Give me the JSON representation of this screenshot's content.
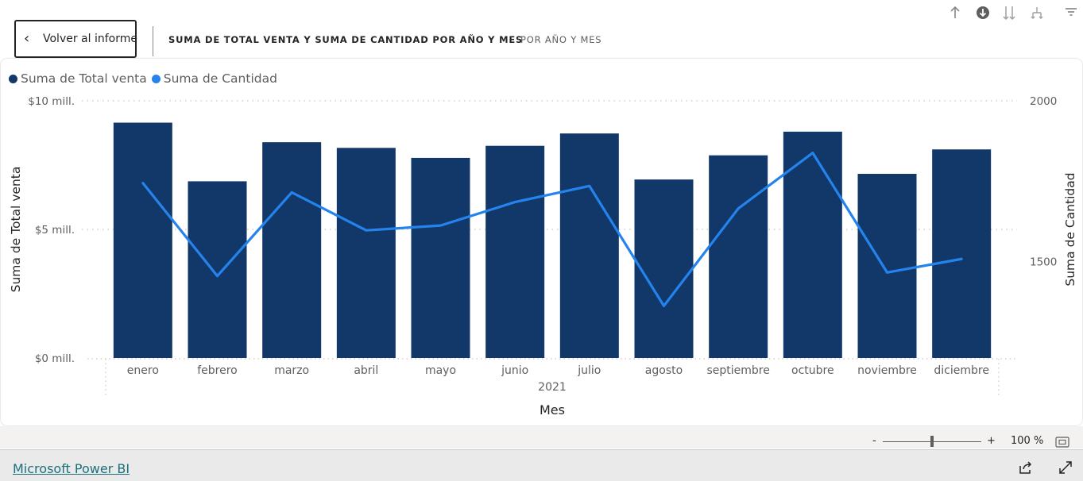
{
  "header": {
    "back_label": "Volver al informe",
    "title_main": "SUMA DE TOTAL VENTA Y SUMA DE CANTIDAD POR AÑO Y MES",
    "title_sub": "POR AÑO Y MES"
  },
  "toolbar_icons": [
    "arrow-up-icon",
    "drill-down-icon",
    "expand-all-down-icon",
    "expand-hierarchy-icon",
    "filter-icon"
  ],
  "legend": {
    "items": [
      {
        "label": "Suma de Total venta",
        "color": "#12386a"
      },
      {
        "label": "Suma de Cantidad",
        "color": "#2483ec"
      }
    ]
  },
  "chart_data": {
    "type": "bar",
    "combo": "bar+line",
    "categories": [
      "enero",
      "febrero",
      "marzo",
      "abril",
      "mayo",
      "junio",
      "julio",
      "agosto",
      "septiembre",
      "octubre",
      "noviembre",
      "diciembre"
    ],
    "x_group_label": "2021",
    "xlabel": "Mes",
    "ylabel": "Suma de Total venta",
    "y2label": "Suma de Cantidad",
    "ylim": [
      0,
      10000000
    ],
    "y2lim": [
      1200,
      2000
    ],
    "y_ticks": [
      {
        "v": 10000000,
        "label": "$10 mill."
      },
      {
        "v": 5000000,
        "label": "$5 mill."
      },
      {
        "v": 0,
        "label": "$0 mill."
      }
    ],
    "y2_ticks": [
      {
        "v": 2000,
        "label": "2000"
      },
      {
        "v": 1500,
        "label": "1500"
      }
    ],
    "series": [
      {
        "name": "Suma de Total venta",
        "kind": "bar",
        "axis": "left",
        "color": "#12386a",
        "values": [
          9150000,
          6870000,
          8390000,
          8170000,
          7780000,
          8250000,
          8730000,
          6940000,
          7880000,
          8800000,
          7160000,
          8110000
        ]
      },
      {
        "name": "Suma de Cantidad",
        "kind": "line",
        "axis": "right",
        "color": "#2483ec",
        "values": [
          1744,
          1455,
          1715,
          1597,
          1612,
          1685,
          1735,
          1362,
          1665,
          1838,
          1466,
          1508
        ]
      }
    ],
    "grid": "dotted horizontal",
    "legend_position": "top-left"
  },
  "zoom": {
    "minus": "-",
    "plus": "+",
    "level": "100 %"
  },
  "footer": {
    "brand": "Microsoft Power BI"
  }
}
